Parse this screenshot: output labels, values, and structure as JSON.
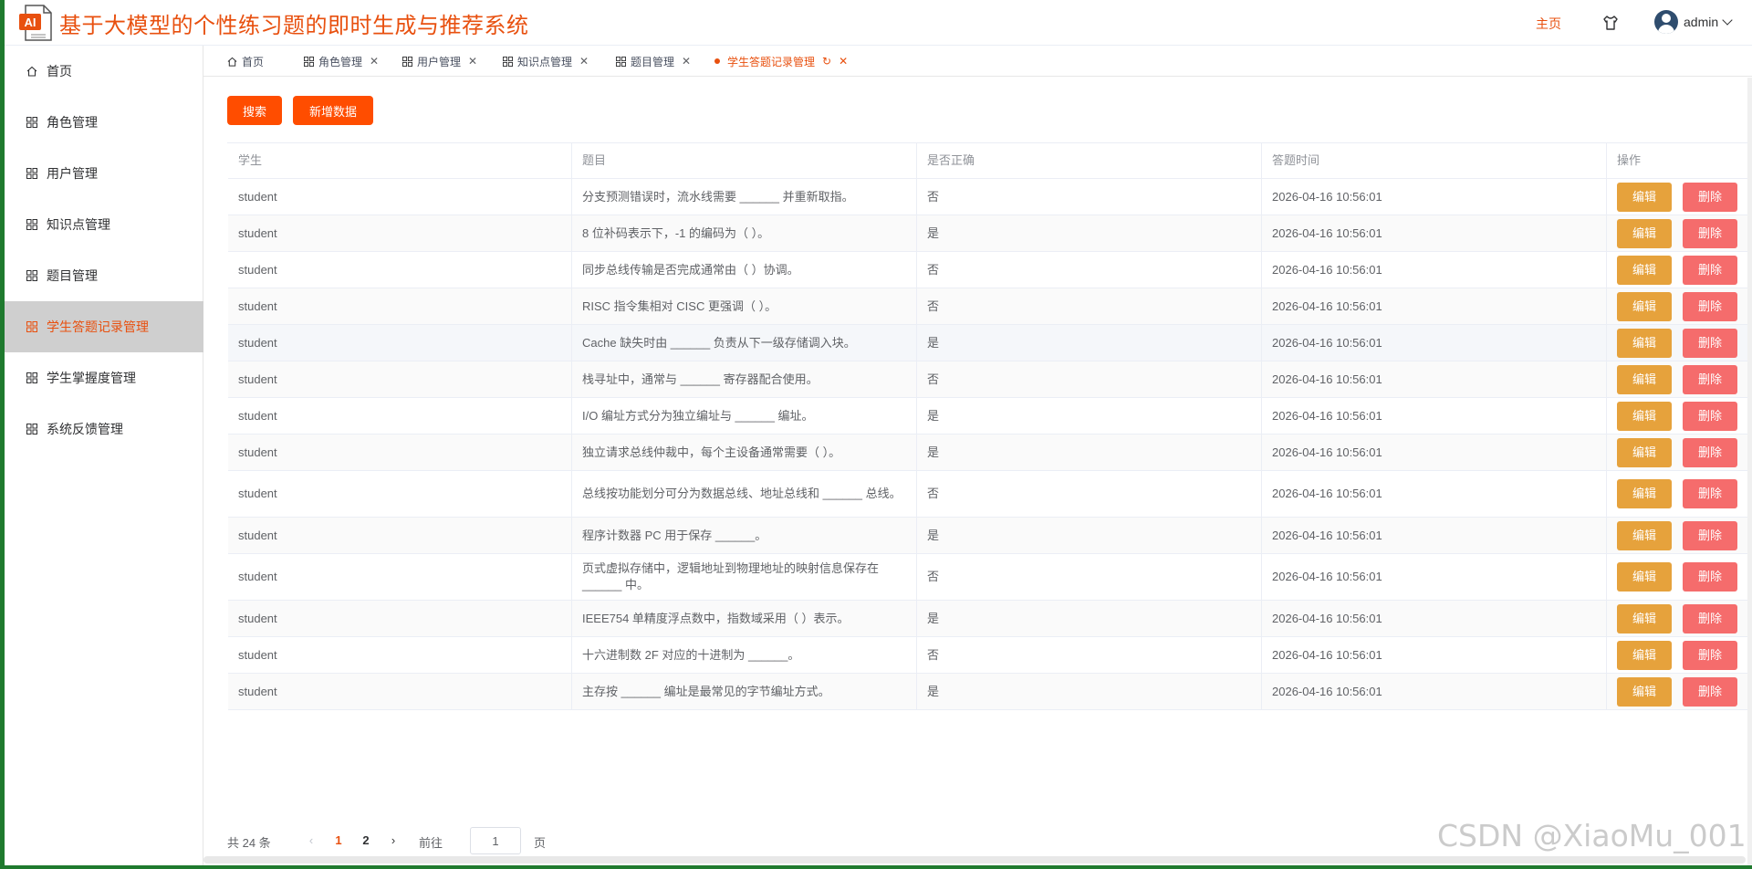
{
  "app": {
    "title": "基于大模型的个性练习题的即时生成与推荐系统",
    "logo_text": "AI",
    "home_link": "主页",
    "user_name": "admin"
  },
  "sidebar": {
    "items": [
      {
        "label": "首页",
        "icon": "home-icon"
      },
      {
        "label": "角色管理",
        "icon": "grid-icon"
      },
      {
        "label": "用户管理",
        "icon": "grid-icon"
      },
      {
        "label": "知识点管理",
        "icon": "grid-icon"
      },
      {
        "label": "题目管理",
        "icon": "grid-icon"
      },
      {
        "label": "学生答题记录管理",
        "icon": "grid-icon",
        "active": true
      },
      {
        "label": "学生掌握度管理",
        "icon": "grid-icon"
      },
      {
        "label": "系统反馈管理",
        "icon": "grid-icon"
      }
    ]
  },
  "tabs": [
    {
      "label": "首页",
      "icon": "home-icon"
    },
    {
      "label": "角色管理",
      "icon": "grid-icon",
      "close": "✕"
    },
    {
      "label": "用户管理",
      "icon": "grid-icon",
      "close": "✕"
    },
    {
      "label": "知识点管理",
      "icon": "grid-icon",
      "close": "✕"
    },
    {
      "label": "题目管理",
      "icon": "grid-icon",
      "close": "✕"
    },
    {
      "label": "学生答题记录管理",
      "active": true,
      "refresh": "↻",
      "close": "✕"
    }
  ],
  "toolbar": {
    "search_label": "搜索",
    "add_label": "新增数据"
  },
  "table": {
    "columns": [
      "学生",
      "题目",
      "是否正确",
      "答题时间",
      "操作"
    ],
    "edit_label": "编辑",
    "delete_label": "删除",
    "rows": [
      {
        "student": "student",
        "question": "分支预测错误时，流水线需要 ______ 并重新取指。",
        "correct": "否",
        "time": "2026-04-16 10:56:01"
      },
      {
        "student": "student",
        "question": "8 位补码表示下，-1 的编码为（ ）。",
        "correct": "是",
        "time": "2026-04-16 10:56:01"
      },
      {
        "student": "student",
        "question": "同步总线传输是否完成通常由（ ）协调。",
        "correct": "否",
        "time": "2026-04-16 10:56:01"
      },
      {
        "student": "student",
        "question": "RISC 指令集相对 CISC 更强调（ ）。",
        "correct": "否",
        "time": "2026-04-16 10:56:01"
      },
      {
        "student": "student",
        "question": "Cache 缺失时由 ______ 负责从下一级存储调入块。",
        "correct": "是",
        "time": "2026-04-16 10:56:01"
      },
      {
        "student": "student",
        "question": "栈寻址中，通常与 ______ 寄存器配合使用。",
        "correct": "否",
        "time": "2026-04-16 10:56:01"
      },
      {
        "student": "student",
        "question": "I/O 编址方式分为独立编址与 ______ 编址。",
        "correct": "是",
        "time": "2026-04-16 10:56:01"
      },
      {
        "student": "student",
        "question": "独立请求总线仲裁中，每个主设备通常需要（ ）。",
        "correct": "是",
        "time": "2026-04-16 10:56:01"
      },
      {
        "student": "student",
        "question": "总线按功能划分可分为数据总线、地址总线和 ______ 总线。",
        "correct": "否",
        "time": "2026-04-16 10:56:01"
      },
      {
        "student": "student",
        "question": "程序计数器 PC 用于保存 ______。",
        "correct": "是",
        "time": "2026-04-16 10:56:01"
      },
      {
        "student": "student",
        "question": "页式虚拟存储中，逻辑地址到物理地址的映射信息保存在 ______ 中。",
        "correct": "否",
        "time": "2026-04-16 10:56:01"
      },
      {
        "student": "student",
        "question": "IEEE754 单精度浮点数中，指数域采用（ ）表示。",
        "correct": "是",
        "time": "2026-04-16 10:56:01"
      },
      {
        "student": "student",
        "question": "十六进制数 2F 对应的十进制为 ______。",
        "correct": "否",
        "time": "2026-04-16 10:56:01"
      },
      {
        "student": "student",
        "question": "主存按 ______ 编址是最常见的字节编址方式。",
        "correct": "是",
        "time": "2026-04-16 10:56:01"
      }
    ]
  },
  "pagination": {
    "total_text": "共 24 条",
    "prev": "‹",
    "pages": [
      "1",
      "2"
    ],
    "current": "1",
    "next": "›",
    "goto_label": "前往",
    "goto_value": "1",
    "page_label": "页"
  },
  "watermark": "CSDN @XiaoMu_001",
  "colors": {
    "accent": "#e8500f",
    "primary_button": "#ff4d00",
    "edit_button": "#e6a23c",
    "delete_button": "#f56c6c"
  }
}
